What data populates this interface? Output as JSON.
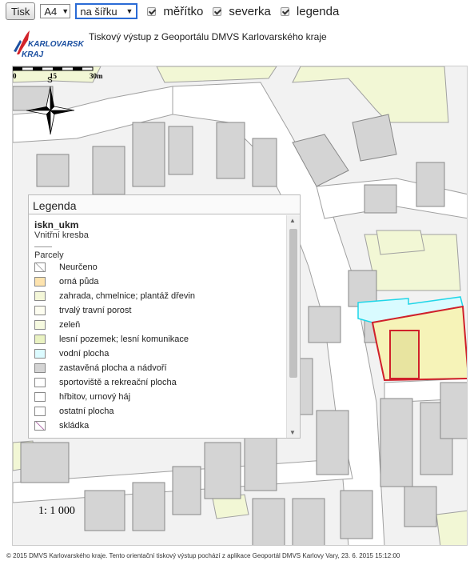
{
  "toolbar": {
    "print_label": "Tisk",
    "paper_size": "A4",
    "orientation": "na šířku",
    "options": [
      {
        "label": "měřítko",
        "checked": true
      },
      {
        "label": "severka",
        "checked": true
      },
      {
        "label": "legenda",
        "checked": true
      }
    ]
  },
  "header": {
    "logo_text_1": "KARLOVARSKÝ",
    "logo_text_2": "KRAJ",
    "title": "Tiskový výstup z Geoportálu DMVS Karlovarského kraje"
  },
  "map": {
    "north_label": "S",
    "scale_text": "1: 1 000",
    "scale_ticks": [
      "0",
      "15",
      "30m"
    ],
    "highlight_color": "#d0202a",
    "water_color": "#d9fbff"
  },
  "legend": {
    "title": "Legenda",
    "layer_name": "iskn_ukm",
    "layer_sub": "Vnitřní kresba",
    "group_label": "Parcely",
    "items": [
      {
        "label": "Neurčeno",
        "color": "#ffffff",
        "hatch": true
      },
      {
        "label": "orná půda",
        "color": "#fde3ae"
      },
      {
        "label": "zahrada, chmelnice; plantáž dřevin",
        "color": "#f4f7d8"
      },
      {
        "label": "trvalý travní porost",
        "color": "#fdfdf0"
      },
      {
        "label": "zeleň",
        "color": "#f6fae0"
      },
      {
        "label": "lesní pozemek; lesní komunikace",
        "color": "#eaf3c2"
      },
      {
        "label": "vodní plocha",
        "color": "#dcfbff"
      },
      {
        "label": "zastavěná plocha a nádvoří",
        "color": "#d4d4d4"
      },
      {
        "label": "sportoviště a rekreační plocha",
        "color": "#ffffff"
      },
      {
        "label": "hřbitov, urnový háj",
        "color": "#ffffff"
      },
      {
        "label": "ostatní plocha",
        "color": "#ffffff"
      },
      {
        "label": "skládka",
        "color": "#ffffff",
        "hatch": true
      }
    ]
  },
  "footer": {
    "text": "© 2015 DMVS Karlovarského kraje. Tento orientační tiskový výstup pochází z aplikace Geoportál DMVS Karlovy Vary, 23. 6. 2015 15:12:00"
  }
}
